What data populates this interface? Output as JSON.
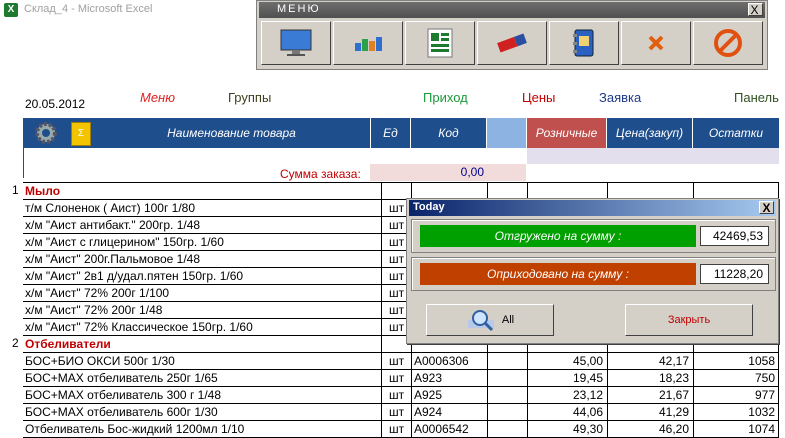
{
  "window": {
    "title": "Склад_4 - Microsoft Excel",
    "app_icon": "excel-icon"
  },
  "menu_window": {
    "title": "МЕНЮ",
    "close": "X",
    "buttons": [
      "monitor-icon",
      "bar-chart-icon",
      "spreadsheet-icon",
      "eraser-icon",
      "contacts-book-icon",
      "cross-icon",
      "stop-icon"
    ]
  },
  "date": "20.05.2012",
  "links": {
    "menu": "Меню",
    "groups": "Группы",
    "income": "Приход",
    "prices": "Цены",
    "request": "Заявка",
    "panel": "Панель"
  },
  "header": {
    "name": "Наименование товара",
    "unit": "Ед",
    "code": "Код",
    "retail": "Розничные",
    "price_purchase": "Цена(закуп)",
    "stock": "Остатки"
  },
  "sum": {
    "label": "Сумма заказа:",
    "value": "0,00"
  },
  "rows": [
    {
      "n": "1",
      "name": "Мыло",
      "group": true,
      "unit": "",
      "code": "",
      "retail": "",
      "purchase": "",
      "stock": ""
    },
    {
      "n": "",
      "name": "т/м Слоненок ( Аист) 100г 1/80",
      "unit": "шт",
      "code": "",
      "retail": "",
      "purchase": "",
      "stock": ""
    },
    {
      "n": "",
      "name": "х/м \"Аист антибакт.\" 200гр. 1/48",
      "unit": "шт",
      "code": "",
      "retail": "",
      "purchase": "",
      "stock": ""
    },
    {
      "n": "",
      "name": "х/м \"Аист с глицерином\" 150гр. 1/60",
      "unit": "шт",
      "code": "",
      "retail": "",
      "purchase": "",
      "stock": ""
    },
    {
      "n": "",
      "name": "х/м \"Аист\" 200г.Пальмовое 1/48",
      "unit": "шт",
      "code": "",
      "retail": "",
      "purchase": "",
      "stock": ""
    },
    {
      "n": "",
      "name": "х/м \"Аист\" 2в1 д/удал.пятен 150гр. 1/60",
      "unit": "шт",
      "code": "",
      "retail": "",
      "purchase": "",
      "stock": ""
    },
    {
      "n": "",
      "name": "х/м \"Аист\" 72% 200г 1/100",
      "unit": "шт",
      "code": "",
      "retail": "",
      "purchase": "",
      "stock": ""
    },
    {
      "n": "",
      "name": "х/м \"Аист\" 72% 200г 1/48",
      "unit": "шт",
      "code": "",
      "retail": "",
      "purchase": "",
      "stock": ""
    },
    {
      "n": "",
      "name": "х/м \"Аист\" 72% Классическое 150гр. 1/60",
      "unit": "шт",
      "code": "",
      "retail": "",
      "purchase": "",
      "stock": ""
    },
    {
      "n": "2",
      "name": "Отбеливатели",
      "group": true,
      "unit": "",
      "code": "",
      "retail": "",
      "purchase": "",
      "stock": ""
    },
    {
      "n": "",
      "name": "БОС+БИО ОКСИ 500г 1/30",
      "unit": "шт",
      "code": "A0006306",
      "retail": "45,00",
      "purchase": "42,17",
      "stock": "1058"
    },
    {
      "n": "",
      "name": "БОС+MAX отбеливатель 250г 1/65",
      "unit": "шт",
      "code": "A923",
      "retail": "19,45",
      "purchase": "18,23",
      "stock": "750"
    },
    {
      "n": "",
      "name": "БОС+MAX отбеливатель 300 г 1/48",
      "unit": "шт",
      "code": "A925",
      "retail": "23,12",
      "purchase": "21,67",
      "stock": "977"
    },
    {
      "n": "",
      "name": "БОС+MAX отбеливатель 600г 1/30",
      "unit": "шт",
      "code": "A924",
      "retail": "44,06",
      "purchase": "41,29",
      "stock": "1032"
    },
    {
      "n": "",
      "name": "Отбеливатель Бос-жидкий 1200мл 1/10",
      "unit": "шт",
      "code": "A0006542",
      "retail": "49,30",
      "purchase": "46,20",
      "stock": "1074"
    }
  ],
  "dialog": {
    "title": "Today",
    "close": "X",
    "shipped_label": "Отгружено на сумму :",
    "shipped_value": "42469,53",
    "received_label": "Оприходовано на сумму :",
    "received_value": "11228,20",
    "all_label": "All",
    "close_label": "Закрыть"
  },
  "colors": {
    "header_bg": "#1f4e8c",
    "retail_bg": "#c0504d",
    "shipped_bar": "#00a000",
    "received_bar": "#c04000"
  }
}
